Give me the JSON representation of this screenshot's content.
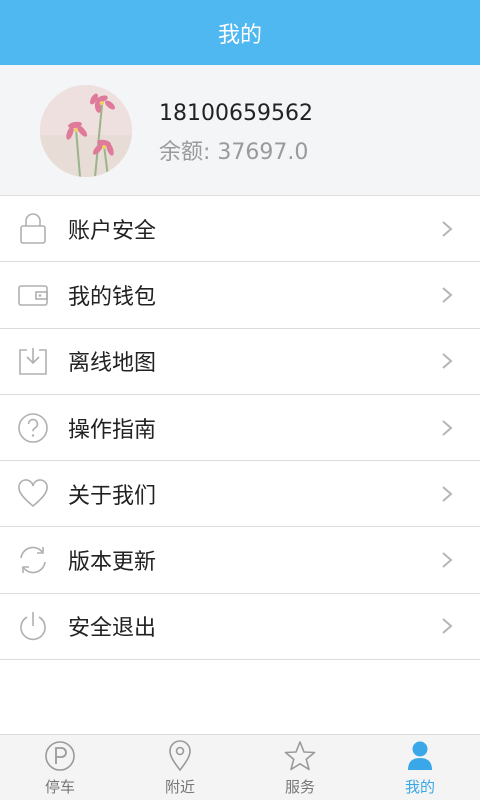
{
  "header": {
    "title": "我的"
  },
  "profile": {
    "phone": "18100659562",
    "balance_label": "余额:",
    "balance_value": "37697.0"
  },
  "menu": {
    "items": [
      {
        "label": "账户安全",
        "icon": "lock-icon"
      },
      {
        "label": "我的钱包",
        "icon": "wallet-icon"
      },
      {
        "label": "离线地图",
        "icon": "download-icon"
      },
      {
        "label": "操作指南",
        "icon": "help-icon"
      },
      {
        "label": "关于我们",
        "icon": "heart-icon"
      },
      {
        "label": "版本更新",
        "icon": "refresh-icon"
      },
      {
        "label": "安全退出",
        "icon": "power-icon"
      }
    ]
  },
  "tabbar": {
    "tabs": [
      {
        "label": "停车",
        "icon": "parking-icon",
        "active": false
      },
      {
        "label": "附近",
        "icon": "location-pin-icon",
        "active": false
      },
      {
        "label": "服务",
        "icon": "star-icon",
        "active": false
      },
      {
        "label": "我的",
        "icon": "user-icon",
        "active": true
      }
    ]
  },
  "colors": {
    "accent": "#4fb8f0",
    "active_tab": "#3aa7e8",
    "icon_stroke": "#b0b0b0"
  }
}
